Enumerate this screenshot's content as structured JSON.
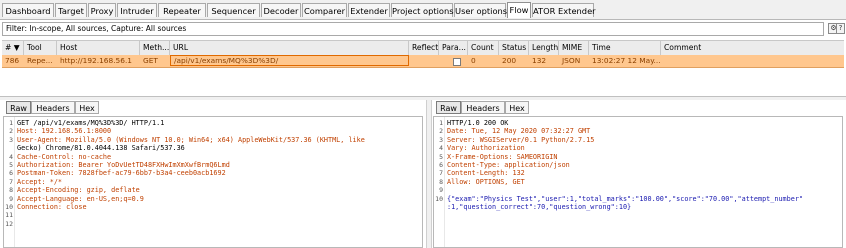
{
  "tabs": [
    "Dashboard",
    "Target",
    "Proxy",
    "Intruder",
    "Repeater",
    "Sequencer",
    "Decoder",
    "Comparer",
    "Extender",
    "Project options",
    "User options",
    "Flow",
    "ATOR Extender"
  ],
  "active_tab": "Flow",
  "filter": "Filter: In-scope, All sources, Capture: All sources",
  "table": {
    "headers": [
      "#",
      "Tool",
      "Host",
      "Meth...",
      "URL",
      "Reflect",
      "Para...",
      "Count",
      "Status",
      "Length",
      "MIME",
      "Time",
      "Comment"
    ],
    "row": {
      "num": "786",
      "tool": "Repe...",
      "host": "http://192.168.56.1",
      "method": "GET",
      "url": "/api/v1/exams/MQ%3D%3D/",
      "reflect": "",
      "params_checked": false,
      "count": "0",
      "status": "200",
      "length": "132",
      "mime": "JSON",
      "time": "13:02:27 12 May...",
      "comment": ""
    }
  },
  "request_tabs": [
    "Raw",
    "Headers",
    "Hex"
  ],
  "response_tabs": [
    "Raw",
    "Headers",
    "Hex"
  ],
  "request_lines": [
    "GET /api/v1/exams/MQ%3D%3D/ HTTP/1.1",
    "Host: 192.168.56.1:8000",
    "User-Agent: Mozilla/5.0 (Windows NT 10.0; Win64; x64) AppleWebKit/537.36 (KHTML, like",
    "Gecko) Chrome/81.0.4044.138 Safari/537.36",
    "Cache-Control: no-cache",
    "Authorization: Bearer YoDvUetTD48FXHwImXmXwfBrmQ6Lmd",
    "Postman-Token: 7828fbef-ac79-6bb7-b3a4-ceeb0acb1692",
    "Accept: */*",
    "Accept-Encoding: gzip, deflate",
    "Accept-Language: en-US,en;q=0.9",
    "Connection: close",
    "",
    ""
  ],
  "request_line_numbers": [
    "1",
    "2",
    "3",
    "",
    "4",
    "5",
    "6",
    "7",
    "8",
    "9",
    "10",
    "11",
    "12"
  ],
  "response_lines": [
    "HTTP/1.0 200 OK",
    "Date: Tue, 12 May 2020 07:32:27 GMT",
    "Server: WSGIServer/0.1 Python/2.7.15",
    "Vary: Authorization",
    "X-Frame-Options: SAMEORIGIN",
    "Content-Type: application/json",
    "Content-Length: 132",
    "Allow: OPTIONS, GET",
    "",
    "{\"exam\":\"Physics Test\",\"user\":1,\"total_marks\":\"100.00\",\"score\":\"70.00\",\"attempt_number\"",
    ":1,\"question_correct\":70,\"question_wrong\":10}"
  ],
  "response_line_numbers": [
    "1",
    "2",
    "3",
    "4",
    "5",
    "6",
    "7",
    "8",
    "9",
    "10",
    ""
  ]
}
